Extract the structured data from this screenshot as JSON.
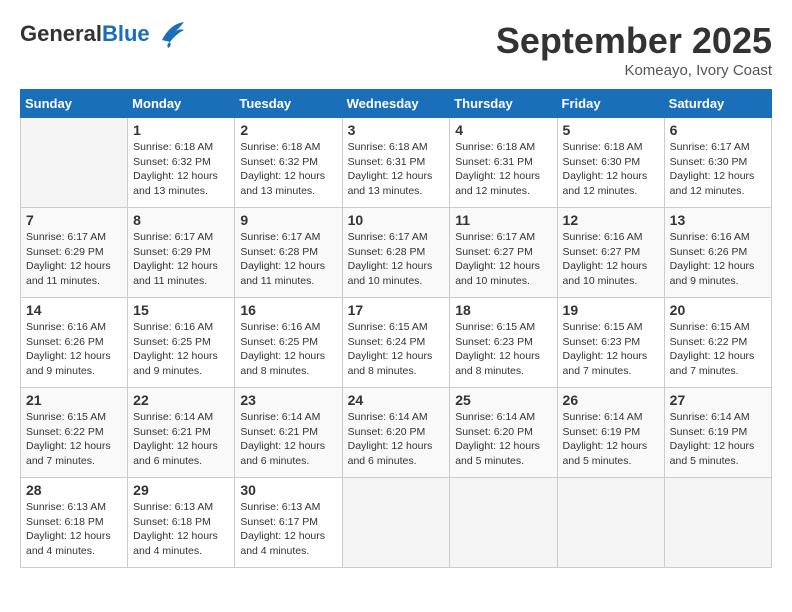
{
  "logo": {
    "general": "General",
    "blue": "Blue"
  },
  "title": {
    "month_year": "September 2025",
    "location": "Komeayo, Ivory Coast"
  },
  "days_of_week": [
    "Sunday",
    "Monday",
    "Tuesday",
    "Wednesday",
    "Thursday",
    "Friday",
    "Saturday"
  ],
  "weeks": [
    [
      {
        "day": "",
        "info": ""
      },
      {
        "day": "1",
        "info": "Sunrise: 6:18 AM\nSunset: 6:32 PM\nDaylight: 12 hours\nand 13 minutes."
      },
      {
        "day": "2",
        "info": "Sunrise: 6:18 AM\nSunset: 6:32 PM\nDaylight: 12 hours\nand 13 minutes."
      },
      {
        "day": "3",
        "info": "Sunrise: 6:18 AM\nSunset: 6:31 PM\nDaylight: 12 hours\nand 13 minutes."
      },
      {
        "day": "4",
        "info": "Sunrise: 6:18 AM\nSunset: 6:31 PM\nDaylight: 12 hours\nand 12 minutes."
      },
      {
        "day": "5",
        "info": "Sunrise: 6:18 AM\nSunset: 6:30 PM\nDaylight: 12 hours\nand 12 minutes."
      },
      {
        "day": "6",
        "info": "Sunrise: 6:17 AM\nSunset: 6:30 PM\nDaylight: 12 hours\nand 12 minutes."
      }
    ],
    [
      {
        "day": "7",
        "info": "Sunrise: 6:17 AM\nSunset: 6:29 PM\nDaylight: 12 hours\nand 11 minutes."
      },
      {
        "day": "8",
        "info": "Sunrise: 6:17 AM\nSunset: 6:29 PM\nDaylight: 12 hours\nand 11 minutes."
      },
      {
        "day": "9",
        "info": "Sunrise: 6:17 AM\nSunset: 6:28 PM\nDaylight: 12 hours\nand 11 minutes."
      },
      {
        "day": "10",
        "info": "Sunrise: 6:17 AM\nSunset: 6:28 PM\nDaylight: 12 hours\nand 10 minutes."
      },
      {
        "day": "11",
        "info": "Sunrise: 6:17 AM\nSunset: 6:27 PM\nDaylight: 12 hours\nand 10 minutes."
      },
      {
        "day": "12",
        "info": "Sunrise: 6:16 AM\nSunset: 6:27 PM\nDaylight: 12 hours\nand 10 minutes."
      },
      {
        "day": "13",
        "info": "Sunrise: 6:16 AM\nSunset: 6:26 PM\nDaylight: 12 hours\nand 9 minutes."
      }
    ],
    [
      {
        "day": "14",
        "info": "Sunrise: 6:16 AM\nSunset: 6:26 PM\nDaylight: 12 hours\nand 9 minutes."
      },
      {
        "day": "15",
        "info": "Sunrise: 6:16 AM\nSunset: 6:25 PM\nDaylight: 12 hours\nand 9 minutes."
      },
      {
        "day": "16",
        "info": "Sunrise: 6:16 AM\nSunset: 6:25 PM\nDaylight: 12 hours\nand 8 minutes."
      },
      {
        "day": "17",
        "info": "Sunrise: 6:15 AM\nSunset: 6:24 PM\nDaylight: 12 hours\nand 8 minutes."
      },
      {
        "day": "18",
        "info": "Sunrise: 6:15 AM\nSunset: 6:23 PM\nDaylight: 12 hours\nand 8 minutes."
      },
      {
        "day": "19",
        "info": "Sunrise: 6:15 AM\nSunset: 6:23 PM\nDaylight: 12 hours\nand 7 minutes."
      },
      {
        "day": "20",
        "info": "Sunrise: 6:15 AM\nSunset: 6:22 PM\nDaylight: 12 hours\nand 7 minutes."
      }
    ],
    [
      {
        "day": "21",
        "info": "Sunrise: 6:15 AM\nSunset: 6:22 PM\nDaylight: 12 hours\nand 7 minutes."
      },
      {
        "day": "22",
        "info": "Sunrise: 6:14 AM\nSunset: 6:21 PM\nDaylight: 12 hours\nand 6 minutes."
      },
      {
        "day": "23",
        "info": "Sunrise: 6:14 AM\nSunset: 6:21 PM\nDaylight: 12 hours\nand 6 minutes."
      },
      {
        "day": "24",
        "info": "Sunrise: 6:14 AM\nSunset: 6:20 PM\nDaylight: 12 hours\nand 6 minutes."
      },
      {
        "day": "25",
        "info": "Sunrise: 6:14 AM\nSunset: 6:20 PM\nDaylight: 12 hours\nand 5 minutes."
      },
      {
        "day": "26",
        "info": "Sunrise: 6:14 AM\nSunset: 6:19 PM\nDaylight: 12 hours\nand 5 minutes."
      },
      {
        "day": "27",
        "info": "Sunrise: 6:14 AM\nSunset: 6:19 PM\nDaylight: 12 hours\nand 5 minutes."
      }
    ],
    [
      {
        "day": "28",
        "info": "Sunrise: 6:13 AM\nSunset: 6:18 PM\nDaylight: 12 hours\nand 4 minutes."
      },
      {
        "day": "29",
        "info": "Sunrise: 6:13 AM\nSunset: 6:18 PM\nDaylight: 12 hours\nand 4 minutes."
      },
      {
        "day": "30",
        "info": "Sunrise: 6:13 AM\nSunset: 6:17 PM\nDaylight: 12 hours\nand 4 minutes."
      },
      {
        "day": "",
        "info": ""
      },
      {
        "day": "",
        "info": ""
      },
      {
        "day": "",
        "info": ""
      },
      {
        "day": "",
        "info": ""
      }
    ]
  ]
}
